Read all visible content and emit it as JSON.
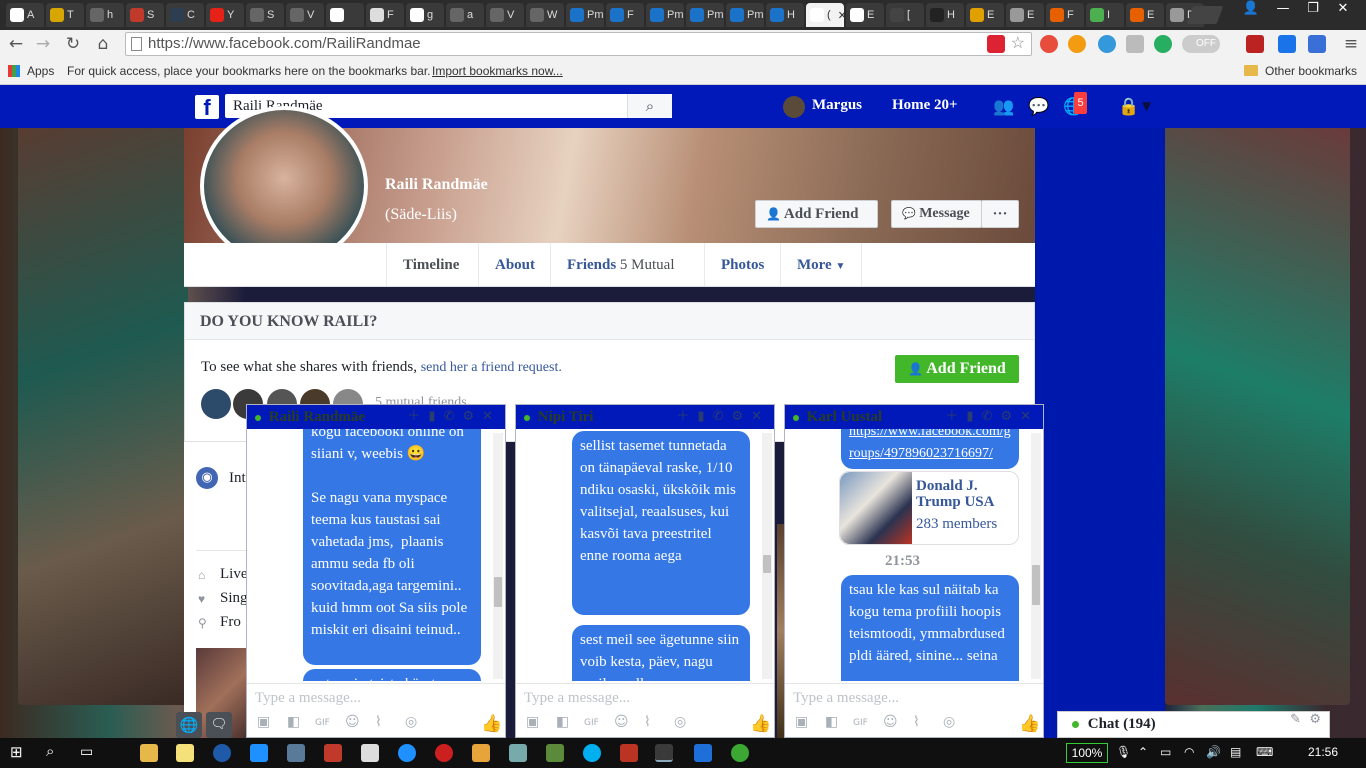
{
  "browser": {
    "tabs": [
      {
        "label": "A",
        "color": "#ffffff"
      },
      {
        "label": "T",
        "color": "#d7a600"
      },
      {
        "label": "h",
        "color": "#666666"
      },
      {
        "label": "S",
        "color": "#c0392b"
      },
      {
        "label": "C",
        "color": "#2c3e50"
      },
      {
        "label": "Y",
        "color": "#e62117"
      },
      {
        "label": "S",
        "color": "#666666"
      },
      {
        "label": "V",
        "color": "#666666"
      },
      {
        "label": "",
        "color": "#ffffff"
      },
      {
        "label": "F",
        "color": "#dddddd"
      },
      {
        "label": "g",
        "color": "#ffffff"
      },
      {
        "label": "a",
        "color": "#666666"
      },
      {
        "label": "V",
        "color": "#666666"
      },
      {
        "label": "W",
        "color": "#666666"
      },
      {
        "label": "Pm",
        "color": "#1a73c9"
      },
      {
        "label": "F",
        "color": "#1a73c9"
      },
      {
        "label": "Pm",
        "color": "#1a73c9"
      },
      {
        "label": "Pm",
        "color": "#1a73c9"
      },
      {
        "label": "Pm",
        "color": "#1a73c9"
      },
      {
        "label": "H",
        "color": "#1a73c9"
      },
      {
        "label": "(",
        "color": "#ffffff"
      },
      {
        "label": "E",
        "color": "#ffffff"
      },
      {
        "label": "[",
        "color": "#444444"
      },
      {
        "label": "H",
        "color": "#222222"
      },
      {
        "label": "E",
        "color": "#e0a000"
      },
      {
        "label": "E",
        "color": "#999999"
      },
      {
        "label": "F",
        "color": "#e66000"
      },
      {
        "label": "I",
        "color": "#4caf50"
      },
      {
        "label": "E",
        "color": "#e66000"
      },
      {
        "label": "D",
        "color": "#999999"
      }
    ],
    "url": "https://www.facebook.com/RailiRandmae",
    "bookmarks": {
      "apps": "Apps",
      "hint": "For quick access, place your bookmarks here on the bookmarks bar.",
      "import_link": "Import bookmarks now...",
      "other": "Other bookmarks"
    },
    "toggle_label": "OFF"
  },
  "fb_nav": {
    "search_value": "Raili Randmäe",
    "user_name": "Margus",
    "home": "Home",
    "home_count": "20+",
    "notif_badge": "5"
  },
  "profile": {
    "name": "Raili Randmäe",
    "alt_name": "(Säde-Liis)",
    "add_friend": "Add Friend",
    "message": "Message",
    "more_dots": "···",
    "tabs": {
      "timeline": "Timeline",
      "about": "About",
      "friends": "Friends",
      "friends_mutual": "5 Mutual",
      "photos": "Photos",
      "more": "More"
    }
  },
  "dyk": {
    "heading": "DO YOU KNOW RAILI?",
    "text": "To see what she shares with friends,",
    "link": "send her a friend request.",
    "add_friend": "Add Friend",
    "mutual_text": "5 mutual friends"
  },
  "left_col": {
    "intro": "Int",
    "lives": "Live",
    "single": "Sing",
    "from": "Fro"
  },
  "chats": [
    {
      "title": "Raili Randmäe",
      "messages": [
        "kogu facebooki online on siiani v, weebis 😀\n\nSe nagu vana myspace teema kus taustasi sai vahetada jms,  plaanis ammu seda fb oli soovitada,aga targemini.. kuid hmm oot Sa siis pole miskit eri disaini teinud..",
        "oot uurin teiste käest"
      ],
      "placeholder": "Type a message..."
    },
    {
      "title": "Nipi Tiri",
      "messages": [
        "sellist tasemet tunnetada on tänapäeval raske, 1/10 ndiku osaski, ükskõik mis valitsejal, reaalsuses, kui kasvõi tava preestritel enne rooma aega",
        "sest meil see ägetunne siin voib kesta, päev, nagu meil on alla"
      ],
      "placeholder": "Type a message..."
    },
    {
      "title": "Karl Uustal",
      "link": "https://www.facebook.com/groups/497896023716697/",
      "group_name": "Donald J. Trump USA",
      "group_members": "283 members",
      "time": "21:53",
      "messages": [
        "tsau kle kas sul näitab ka kogu tema profiili hoopis teismtoodi, ymmabrdused pldi ääred, sinine... seina"
      ],
      "placeholder": "Type a message..."
    }
  ],
  "chat_bar": {
    "label": "Chat (194)"
  },
  "taskbar": {
    "battery": "100%",
    "time": "21:56"
  }
}
